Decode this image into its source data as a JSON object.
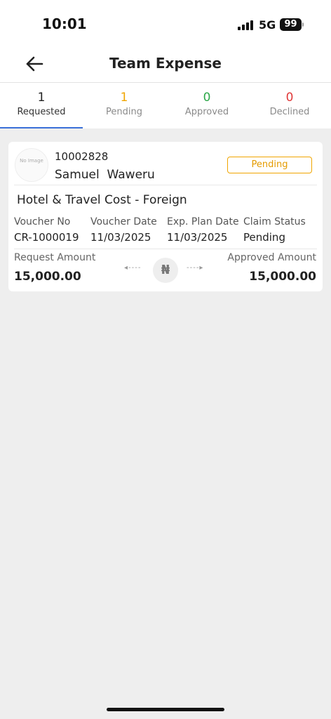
{
  "status_bar": {
    "time": "10:01",
    "network": "5G",
    "battery": "99"
  },
  "header": {
    "title": "Team Expense",
    "back_icon": "arrow-left-icon"
  },
  "tabs": [
    {
      "count": "1",
      "label": "Requested",
      "color": "#222222",
      "active": true
    },
    {
      "count": "1",
      "label": "Pending",
      "color": "#f0a500",
      "active": false
    },
    {
      "count": "0",
      "label": "Approved",
      "color": "#2ea84a",
      "active": false
    },
    {
      "count": "0",
      "label": "Declined",
      "color": "#e03a3a",
      "active": false
    }
  ],
  "card": {
    "avatar_text": "No Image",
    "employee_id": "10002828",
    "employee_name": "Samuel  Waweru",
    "status_badge": "Pending",
    "expense_title": "Hotel & Travel Cost - Foreign",
    "details": [
      {
        "label": "Voucher No",
        "value": "CR-1000019"
      },
      {
        "label": "Voucher Date",
        "value": "11/03/2025"
      },
      {
        "label": "Exp. Plan Date",
        "value": "11/03/2025"
      },
      {
        "label": "Claim Status",
        "value": "Pending"
      }
    ],
    "request_amount_label": "Request Amount",
    "request_amount": "15,000.00",
    "approved_amount_label": "Approved Amount",
    "approved_amount": "15,000.00",
    "currency_symbol": "₦",
    "arrow_left": "◂----",
    "arrow_right": "----▸"
  },
  "colors": {
    "accent": "#3a6fd8",
    "pending": "#f0a500",
    "approved": "#2ea84a",
    "declined": "#e03a3a"
  }
}
